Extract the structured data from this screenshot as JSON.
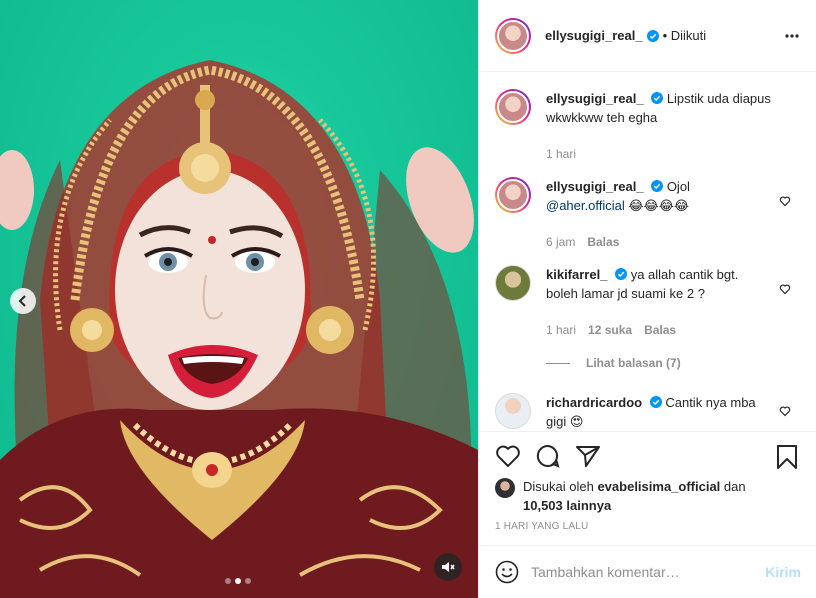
{
  "post": {
    "username": "ellysugigi_real_",
    "follow_state": "• Diikuti",
    "carousel_dots": 3,
    "active_dot": 1
  },
  "comments": [
    {
      "username": "ellysugigi_real_",
      "text": "Lipstik uda diapus wkwkkww teh egha",
      "time": "1 hari"
    },
    {
      "username": "ellysugigi_real_",
      "text_before": "Ojol",
      "mention": "@aher.official",
      "emoji": "😂😂😂😂",
      "time": "6 jam",
      "reply": "Balas"
    },
    {
      "username": "kikifarrel_",
      "text": "ya allah cantik bgt. boleh lamar jd suami ke 2 ?",
      "time": "1 hari",
      "likes": "12 suka",
      "reply": "Balas",
      "view_replies": "Lihat balasan (7)"
    },
    {
      "username": "richardricardoo",
      "text": "Cantik nya mba gigi 😍"
    }
  ],
  "liked_by": {
    "prefix": "Disukai oleh",
    "user": "evabelisima_official",
    "conj": "dan",
    "count": "10,503 lainnya"
  },
  "timestamp": "1 HARI YANG LALU",
  "composer": {
    "placeholder": "Tambahkan komentar…",
    "post_label": "Kirim"
  },
  "colors": {
    "verified": "#0095f6",
    "link": "#00376b",
    "muted": "#8e8e8e",
    "post_disabled": "#b2dffc",
    "media_bg": "#17c79a"
  },
  "icons": {
    "prev": "chevron-left-icon",
    "mute": "muted-speaker-icon",
    "more": "more-horizontal-icon",
    "like": "heart-icon",
    "comment": "comment-icon",
    "share": "share-icon",
    "save": "bookmark-icon",
    "emoji": "emoji-icon"
  }
}
